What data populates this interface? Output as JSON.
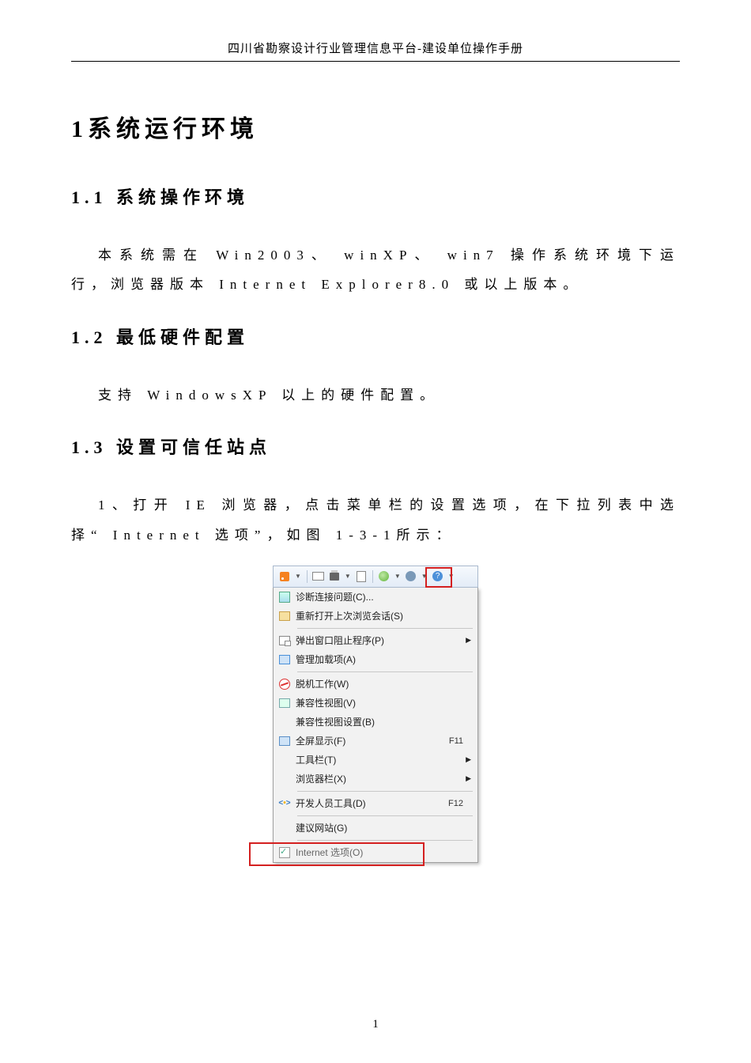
{
  "header": "四川省勘察设计行业管理信息平台-建设单位操作手册",
  "h1": "1系统运行环境",
  "s11_title": "1.1 系统操作环境",
  "s11_body": "本系统需在 Win2003、 winXP、 win7 操作系统环境下运行，浏览器版本 Internet Explorer8.0 或以上版本。",
  "s12_title": "1.2 最低硬件配置",
  "s12_body": "支持 WindowsXP 以上的硬件配置。",
  "s13_title": "1.3 设置可信任站点",
  "s13_body": "1、打开 IE 浏览器，点击菜单栏的设置选项，在下拉列表中选择“ Internet 选项”，如图 1-3-1所示：",
  "page_number": "1",
  "menu": {
    "items": [
      {
        "label": "诊断连接问题(C)...",
        "hint": "",
        "arrow": false
      },
      {
        "label": "重新打开上次浏览会话(S)",
        "hint": "",
        "arrow": false
      }
    ],
    "group2": [
      {
        "label": "弹出窗口阻止程序(P)",
        "hint": "",
        "arrow": true
      },
      {
        "label": "管理加载项(A)",
        "hint": "",
        "arrow": false
      }
    ],
    "group3": [
      {
        "label": "脱机工作(W)",
        "hint": "",
        "arrow": false
      },
      {
        "label": "兼容性视图(V)",
        "hint": "",
        "arrow": false
      },
      {
        "label": "兼容性视图设置(B)",
        "hint": "",
        "arrow": false
      },
      {
        "label": "全屏显示(F)",
        "hint": "F11",
        "arrow": false
      },
      {
        "label": "工具栏(T)",
        "hint": "",
        "arrow": true
      },
      {
        "label": "浏览器栏(X)",
        "hint": "",
        "arrow": true
      }
    ],
    "group4": [
      {
        "label": "开发人员工具(D)",
        "hint": "F12",
        "arrow": false
      }
    ],
    "group5": [
      {
        "label": "建议网站(G)",
        "hint": "",
        "arrow": false
      }
    ],
    "group6": [
      {
        "label": "Internet 选项(O)",
        "hint": "",
        "arrow": false
      }
    ]
  }
}
